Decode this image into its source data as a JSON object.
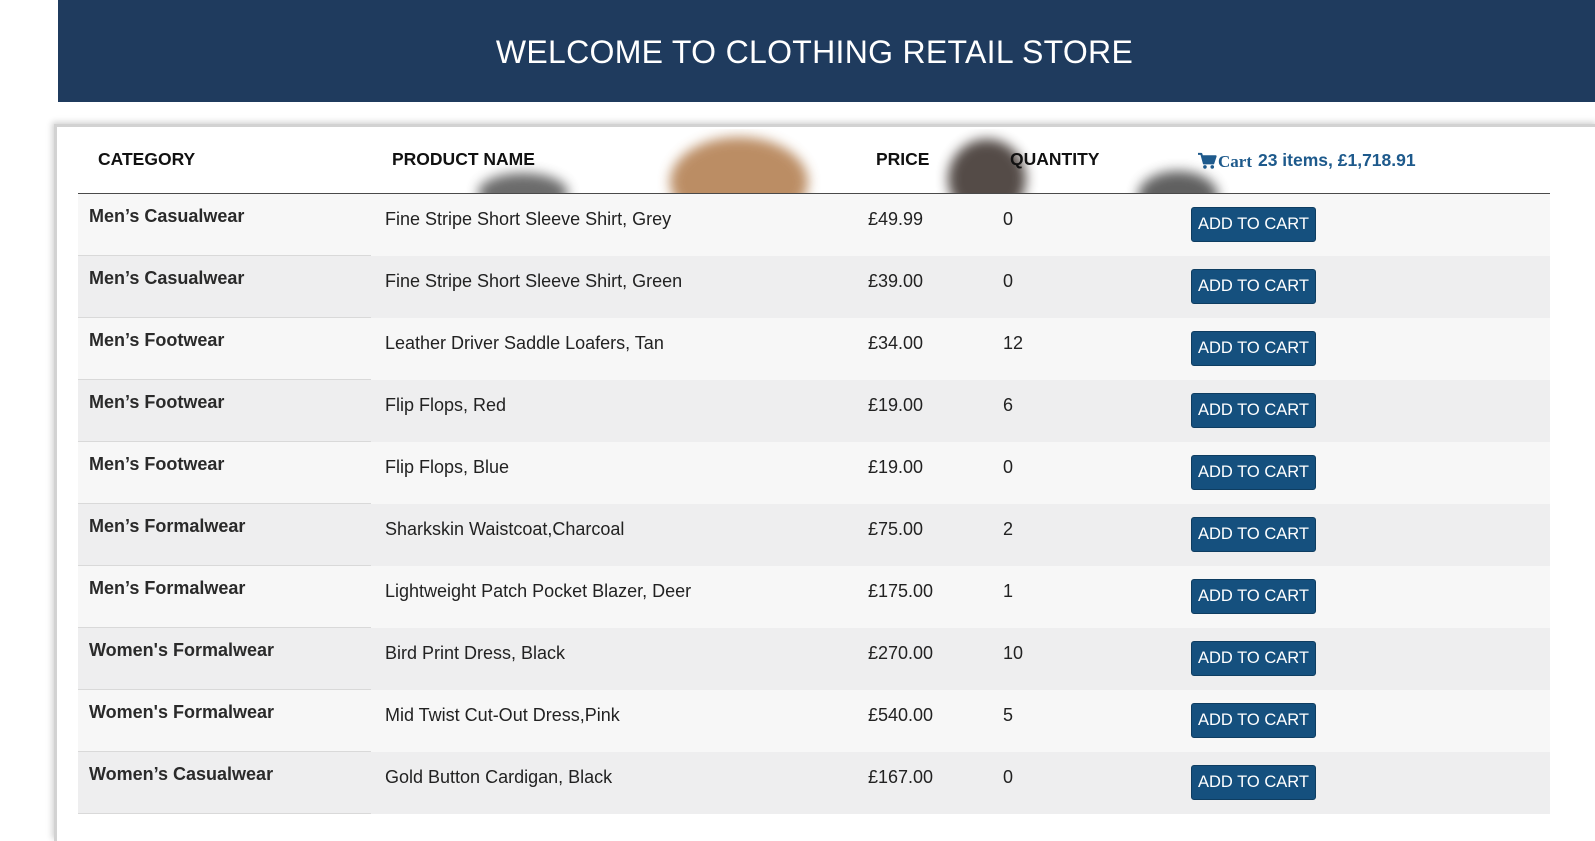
{
  "header": {
    "title": "WELCOME TO CLOTHING RETAIL STORE"
  },
  "table": {
    "columns": {
      "category": "CATEGORY",
      "product_name": "PRODUCT NAME",
      "price": "PRICE",
      "quantity": "QUANTITY"
    },
    "cart": {
      "icon": "shopping-cart-icon",
      "label": "Cart",
      "summary": "23 items, £1,718.91"
    },
    "add_label": "ADD TO CART",
    "rows": [
      {
        "category": "Men’s Casualwear",
        "name": "Fine Stripe Short Sleeve Shirt, Grey",
        "price": "£49.99",
        "quantity": "0"
      },
      {
        "category": "Men’s Casualwear",
        "name": "Fine Stripe Short Sleeve Shirt, Green",
        "price": "£39.00",
        "quantity": "0"
      },
      {
        "category": "Men’s Footwear",
        "name": "Leather Driver Saddle Loafers, Tan",
        "price": "£34.00",
        "quantity": "12"
      },
      {
        "category": "Men’s Footwear",
        "name": "Flip Flops, Red",
        "price": "£19.00",
        "quantity": "6"
      },
      {
        "category": "Men’s Footwear",
        "name": "Flip Flops, Blue",
        "price": "£19.00",
        "quantity": "0"
      },
      {
        "category": "Men’s Formalwear",
        "name": "Sharkskin Waistcoat,Charcoal",
        "price": "£75.00",
        "quantity": "2"
      },
      {
        "category": "Men’s Formalwear",
        "name": "Lightweight Patch Pocket Blazer, Deer",
        "price": "£175.00",
        "quantity": "1"
      },
      {
        "category": "Women's Formalwear",
        "name": "Bird Print Dress, Black",
        "price": "£270.00",
        "quantity": "10"
      },
      {
        "category": "Women's Formalwear",
        "name": "Mid Twist Cut-Out Dress,Pink",
        "price": "£540.00",
        "quantity": "5"
      },
      {
        "category": "Women’s Casualwear",
        "name": "Gold Button Cardigan, Black",
        "price": "£167.00",
        "quantity": "0"
      }
    ]
  },
  "colors": {
    "banner": "#1f3b5e",
    "button": "#15507e",
    "cart_text": "#1e5a8c"
  }
}
